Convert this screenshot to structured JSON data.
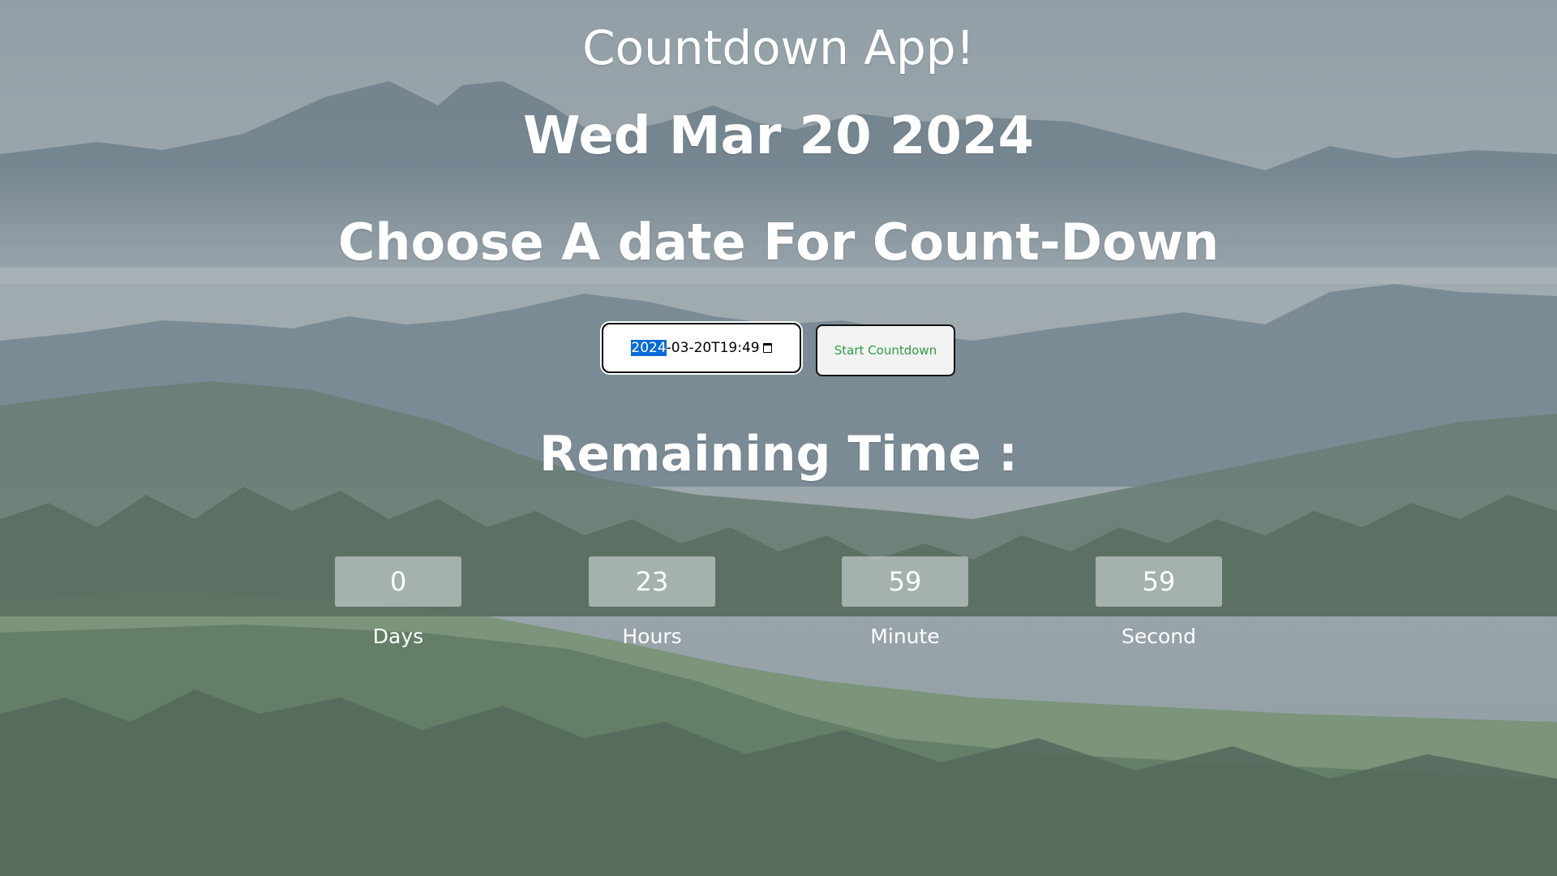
{
  "app": {
    "title": "Countdown App!",
    "current_date": "Wed Mar 20 2024",
    "choose_heading": "Choose A date For Count-Down"
  },
  "date_input": {
    "value_selected_part": "2024",
    "value_rest": "-03-20T19:49",
    "calendar_icon": "calendar-icon"
  },
  "start_button": {
    "label": "Start Countdown",
    "color": "#2f9e44"
  },
  "remaining": {
    "heading": "Remaining Time :",
    "units": [
      {
        "value": "0",
        "label": "Days"
      },
      {
        "value": "23",
        "label": "Hours"
      },
      {
        "value": "59",
        "label": "Minute"
      },
      {
        "value": "59",
        "label": "Second"
      }
    ]
  },
  "colors": {
    "text": "#ffffff",
    "selection": "#0a6bd6"
  }
}
